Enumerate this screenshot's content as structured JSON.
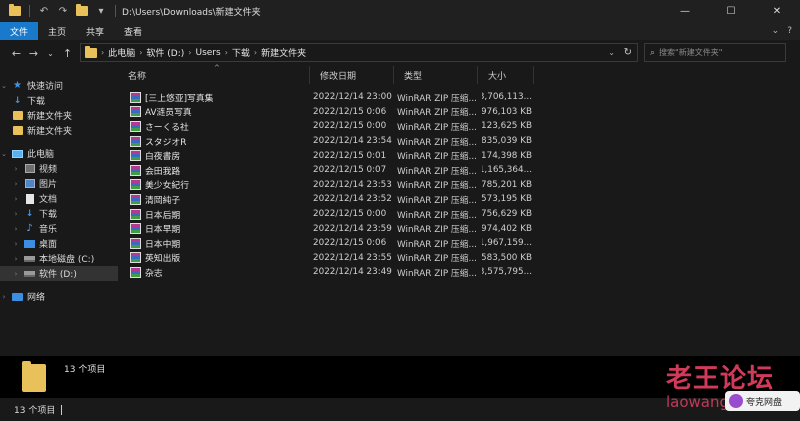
{
  "window": {
    "title_path": "D:\\Users\\Downloads\\新建文件夹",
    "controls": {
      "minimize": "—",
      "maximize": "☐",
      "close": "✕"
    }
  },
  "ribbon": {
    "tabs": [
      "文件",
      "主页",
      "共享",
      "查看"
    ],
    "active_tab": "文件"
  },
  "address": {
    "breadcrumbs": [
      "此电脑",
      "软件 (D:)",
      "Users",
      "下载",
      "新建文件夹"
    ],
    "search_placeholder": "搜索\"新建文件夹\""
  },
  "nav": {
    "quick_access": "快速访问",
    "quick_items": [
      "下载",
      "新建文件夹",
      "新建文件夹"
    ],
    "this_pc": "此电脑",
    "pc_items": [
      "视频",
      "图片",
      "文档",
      "下载",
      "音乐",
      "桌面",
      "本地磁盘 (C:)",
      "软件 (D:)"
    ],
    "network": "网络"
  },
  "columns": {
    "name": "名称",
    "date": "修改日期",
    "type": "类型",
    "size": "大小"
  },
  "files": [
    {
      "name": "[三上悠亚]写真集",
      "date": "2022/12/14 23:00",
      "type": "WinRAR ZIP 压缩...",
      "size": "3,706,113..."
    },
    {
      "name": "AV涟员写真",
      "date": "2022/12/15 0:06",
      "type": "WinRAR ZIP 压缩...",
      "size": "976,103 KB"
    },
    {
      "name": "さーくる社",
      "date": "2022/12/15 0:00",
      "type": "WinRAR ZIP 压缩...",
      "size": "123,625 KB"
    },
    {
      "name": "スタジオR",
      "date": "2022/12/14 23:54",
      "type": "WinRAR ZIP 压缩...",
      "size": "835,039 KB"
    },
    {
      "name": "白夜書房",
      "date": "2022/12/15 0:01",
      "type": "WinRAR ZIP 压缩...",
      "size": "174,398 KB"
    },
    {
      "name": "会田我路",
      "date": "2022/12/15 0:07",
      "type": "WinRAR ZIP 压缩...",
      "size": "1,165,364..."
    },
    {
      "name": "美少女紀行",
      "date": "2022/12/14 23:53",
      "type": "WinRAR ZIP 压缩...",
      "size": "785,201 KB"
    },
    {
      "name": "清岡純子",
      "date": "2022/12/14 23:52",
      "type": "WinRAR ZIP 压缩...",
      "size": "573,195 KB"
    },
    {
      "name": "日本后期",
      "date": "2022/12/15 0:00",
      "type": "WinRAR ZIP 压缩...",
      "size": "756,629 KB"
    },
    {
      "name": "日本早期",
      "date": "2022/12/14 23:59",
      "type": "WinRAR ZIP 压缩...",
      "size": "974,402 KB"
    },
    {
      "name": "日本中期",
      "date": "2022/12/15 0:06",
      "type": "WinRAR ZIP 压缩...",
      "size": "1,967,159..."
    },
    {
      "name": "英知出版",
      "date": "2022/12/14 23:55",
      "type": "WinRAR ZIP 压缩...",
      "size": "583,500 KB"
    },
    {
      "name": "杂志",
      "date": "2022/12/14 23:49",
      "type": "WinRAR ZIP 压缩...",
      "size": "3,575,795..."
    }
  ],
  "details": {
    "count_text": "13 个项目"
  },
  "status": {
    "count_text": "13 个项目"
  },
  "watermark": {
    "title": "老王论坛",
    "subtitle": "laowang",
    "badge": "夸克网盘"
  },
  "colors": {
    "accent": "#1979ca",
    "background": "#191919",
    "folder": "#e8c15a"
  }
}
